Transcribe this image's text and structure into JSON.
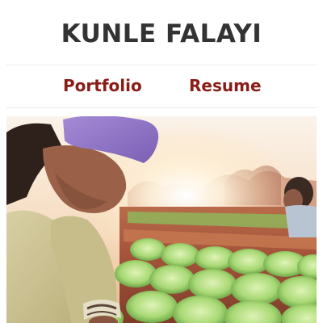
{
  "site": {
    "title": "KUNLE FALAYI"
  },
  "nav": {
    "items": [
      {
        "label": "Portfolio"
      },
      {
        "label": "Resume"
      }
    ]
  },
  "colors": {
    "title": "#333333",
    "nav_link": "#8a1c16",
    "divider": "#ececec",
    "background": "#ffffff"
  },
  "hero": {
    "subject": "farm workers harvesting lettuce at sunset"
  }
}
